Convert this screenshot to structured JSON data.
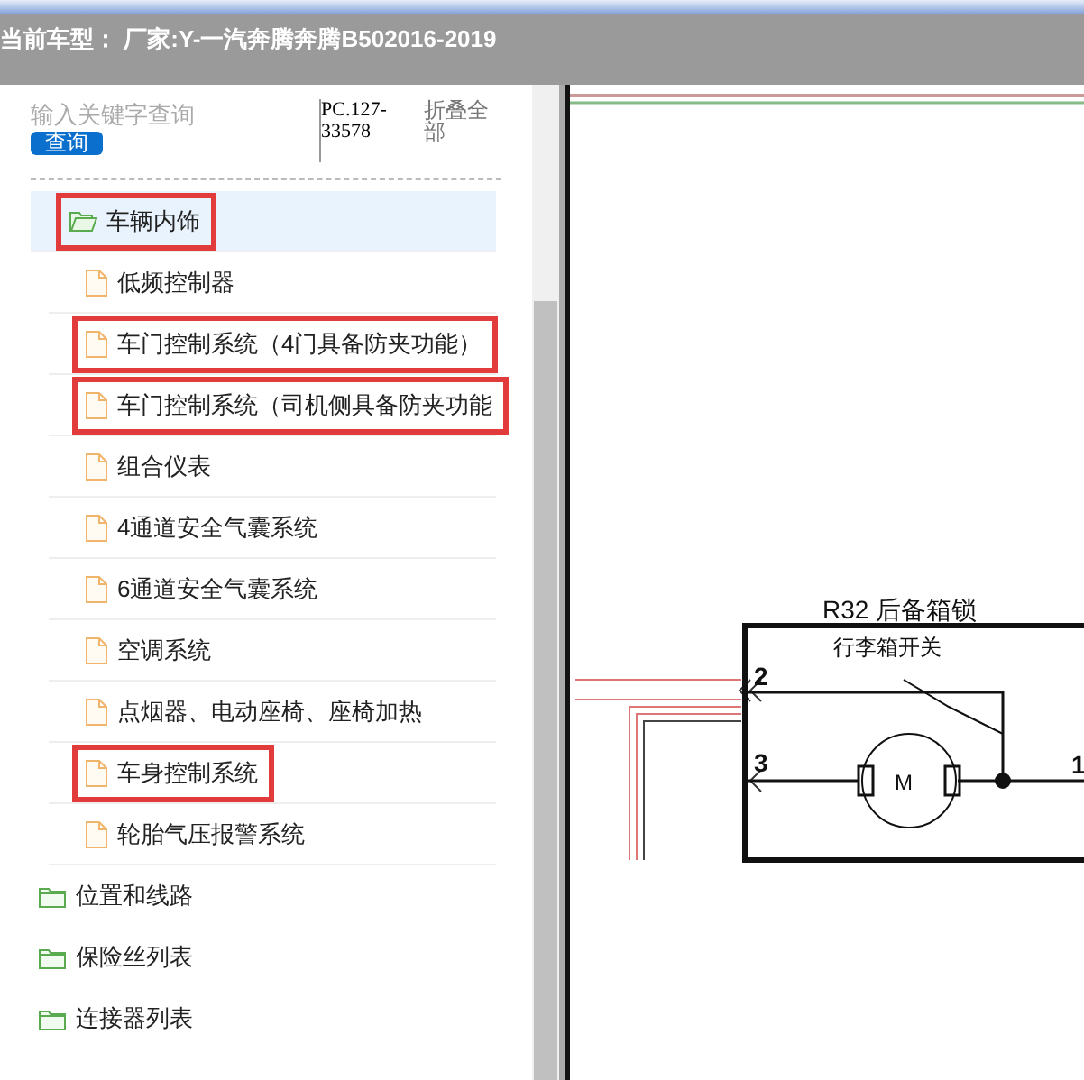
{
  "header": {
    "title": "当前车型： 厂家:Y-一汽奔腾奔腾B502016-2019"
  },
  "search": {
    "placeholder": "输入关键字查询",
    "button": "查询",
    "code": "PC.127-33578",
    "collapse_all": "折叠全部"
  },
  "tree": [
    {
      "children": [
        {
          "label": "车辆内饰",
          "kind": "folder",
          "expanded": true,
          "selected": true,
          "annotated": true,
          "children": [
            {
              "label": "低频控制器",
              "kind": "file",
              "selected": false,
              "annotated": false
            },
            {
              "label": "车门控制系统（4门具备防夹功能）",
              "kind": "file",
              "selected": false,
              "annotated": true
            },
            {
              "label": "车门控制系统（司机侧具备防夹功能",
              "kind": "file",
              "selected": false,
              "annotated": true
            },
            {
              "label": "组合仪表",
              "kind": "file",
              "selected": false,
              "annotated": false
            },
            {
              "label": "4通道安全气囊系统",
              "kind": "file",
              "selected": false,
              "annotated": false
            },
            {
              "label": "6通道安全气囊系统",
              "kind": "file",
              "selected": false,
              "annotated": false
            },
            {
              "label": "空调系统",
              "kind": "file",
              "selected": false,
              "annotated": false
            },
            {
              "label": "点烟器、电动座椅、座椅加热",
              "kind": "file",
              "selected": false,
              "annotated": false
            },
            {
              "label": "车身控制系统",
              "kind": "file",
              "selected": false,
              "annotated": true
            },
            {
              "label": "轮胎气压报警系统",
              "kind": "file",
              "selected": false,
              "annotated": false
            }
          ]
        }
      ]
    },
    {
      "label": "位置和线路",
      "kind": "folder",
      "expanded": false,
      "selected": false,
      "annotated": false
    },
    {
      "label": "保险丝列表",
      "kind": "folder",
      "expanded": false,
      "selected": false,
      "annotated": false
    },
    {
      "label": "连接器列表",
      "kind": "folder",
      "expanded": false,
      "selected": false,
      "annotated": false
    }
  ],
  "diagram": {
    "component": "R32 后备箱锁",
    "switch": "行李箱开关",
    "motor": "M",
    "pins": [
      "2",
      "3",
      "1"
    ]
  }
}
